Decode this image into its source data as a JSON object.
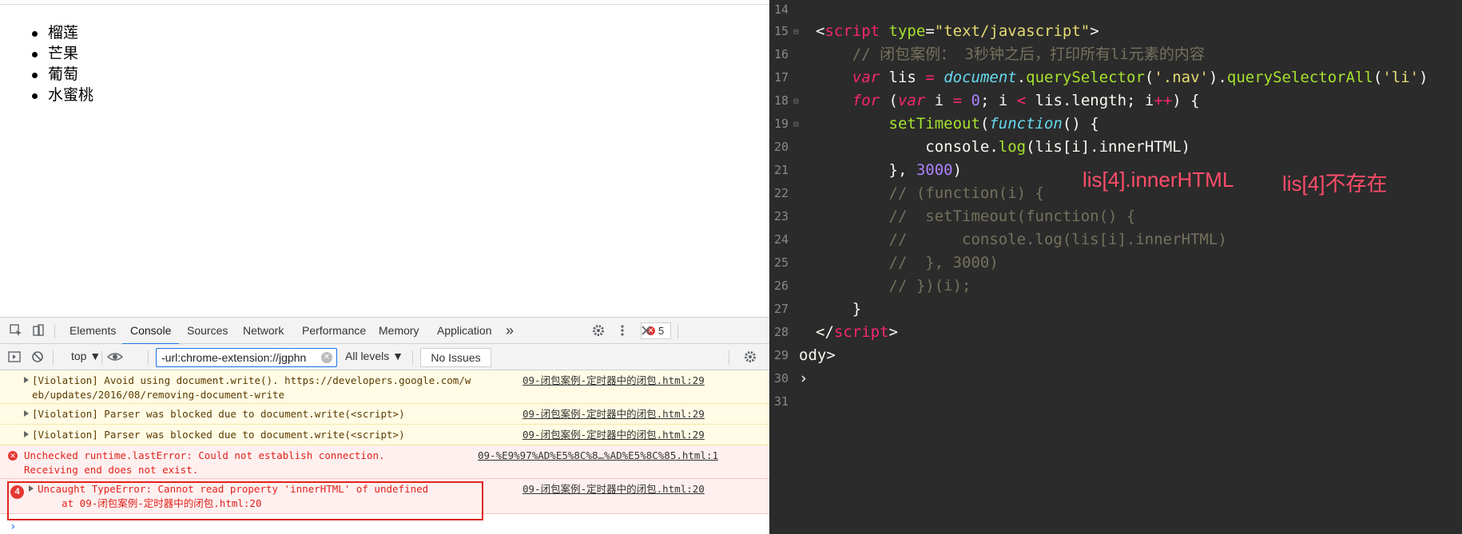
{
  "page": {
    "fruits": [
      "榴莲",
      "芒果",
      "葡萄",
      "水蜜桃"
    ]
  },
  "devtools": {
    "tabs": [
      "Elements",
      "Console",
      "Sources",
      "Network",
      "Performance",
      "Memory",
      "Application"
    ],
    "active_tab": "Console",
    "more_tabs": "»",
    "error_count": "5",
    "context": "top ▼",
    "filter_value": "-url:chrome-extension://jgphn",
    "levels": "All levels ▼",
    "issues": "No Issues",
    "messages": [
      {
        "type": "warn",
        "text": "[Violation] Avoid using document.write(). https://developers.google.com/w\neb/updates/2016/08/removing-document-write",
        "source": "09-闭包案例-定时器中的闭包.html:29"
      },
      {
        "type": "warn",
        "text": "[Violation] Parser was blocked due to document.write(<script>)",
        "source": "09-闭包案例-定时器中的闭包.html:29"
      },
      {
        "type": "warn",
        "text": "[Violation] Parser was blocked due to document.write(<script>)",
        "source": "09-闭包案例-定时器中的闭包.html:29"
      },
      {
        "type": "error",
        "text": "Unchecked runtime.lastError: Could not establish connection.\nReceiving end does not exist.",
        "source": "09-%E9%97%AD%E5%8C%8…%AD%E5%8C%85.html:1"
      },
      {
        "type": "error",
        "count": "4",
        "text": "Uncaught TypeError: Cannot read property 'innerHTML' of undefined\n    at 09-闭包案例-定时器中的闭包.html:20",
        "source": "09-闭包案例-定时器中的闭包.html:20"
      }
    ],
    "prompt": "›"
  },
  "editor": {
    "line_numbers": [
      "14",
      "15",
      "16",
      "17",
      "18",
      "19",
      "20",
      "21",
      "22",
      "23",
      "24",
      "25",
      "26",
      "27",
      "28",
      "29",
      "30",
      "31"
    ],
    "annotation_1": "lis[4].innerHTML",
    "annotation_2": "lis[4]不存在"
  }
}
